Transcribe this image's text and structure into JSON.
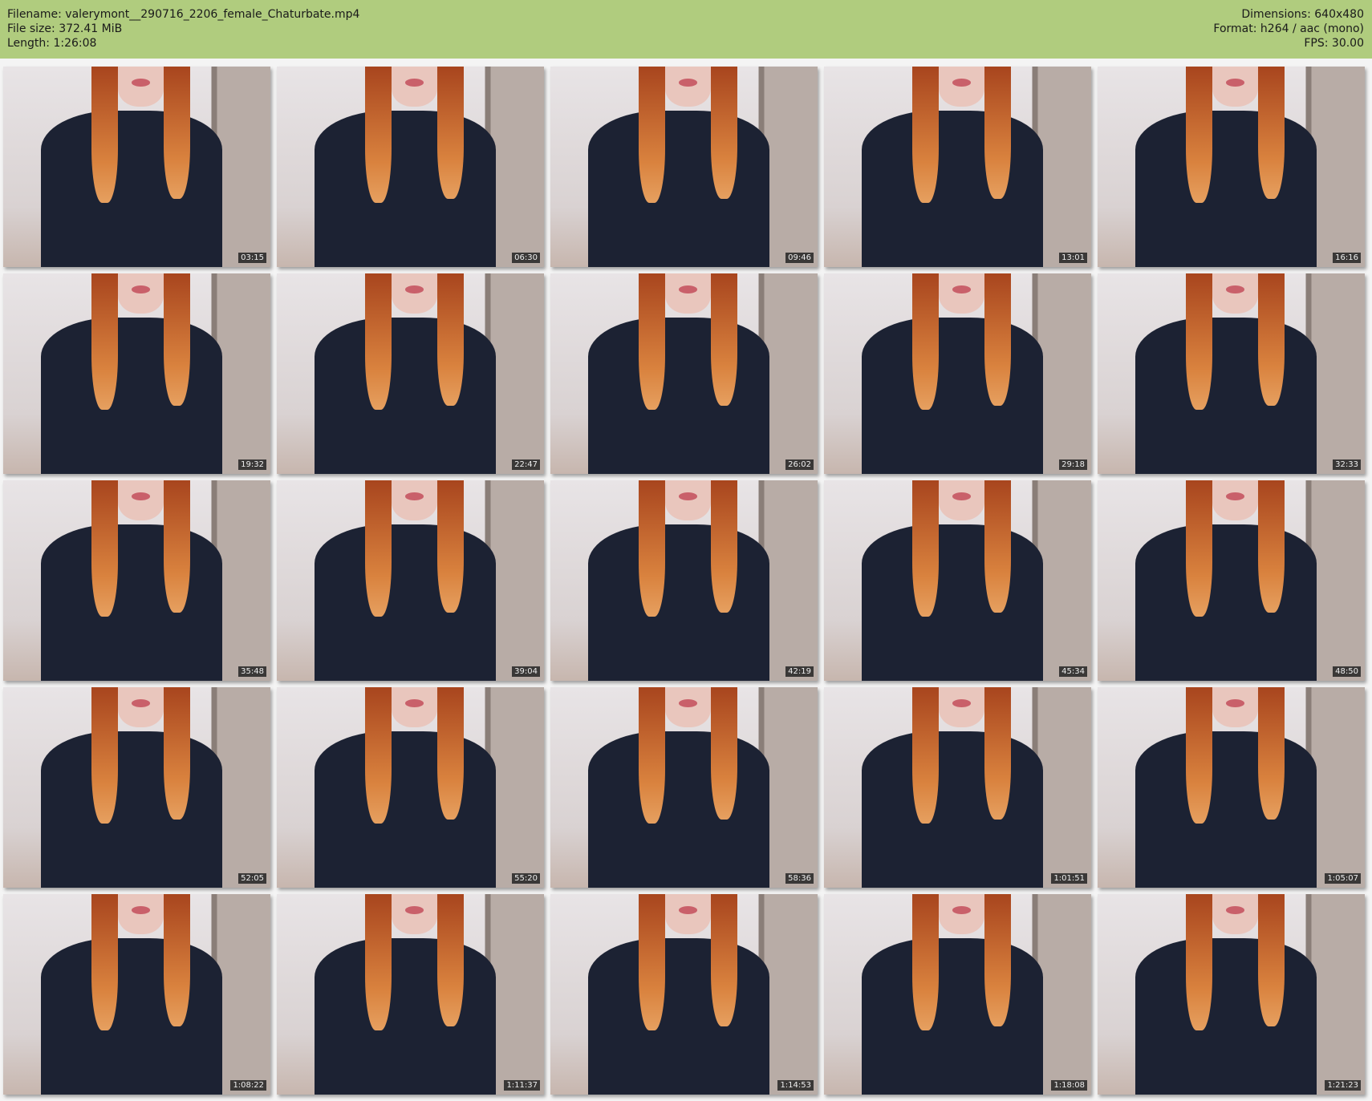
{
  "header": {
    "filename": "Filename: valerymont__290716_2206_female_Chaturbate.mp4",
    "filesize": "File size: 372.41 MiB",
    "length": "Length: 1:26:08",
    "dimensions": "Dimensions: 640x480",
    "format": "Format: h264 / aac (mono)",
    "fps": "FPS: 30.00"
  },
  "thumbnails": [
    "03:15",
    "06:30",
    "09:46",
    "13:01",
    "16:16",
    "19:32",
    "22:47",
    "26:02",
    "29:18",
    "32:33",
    "35:48",
    "39:04",
    "42:19",
    "45:34",
    "48:50",
    "52:05",
    "55:20",
    "58:36",
    "1:01:51",
    "1:05:07",
    "1:08:22",
    "1:11:37",
    "1:14:53",
    "1:18:08",
    "1:21:23"
  ]
}
